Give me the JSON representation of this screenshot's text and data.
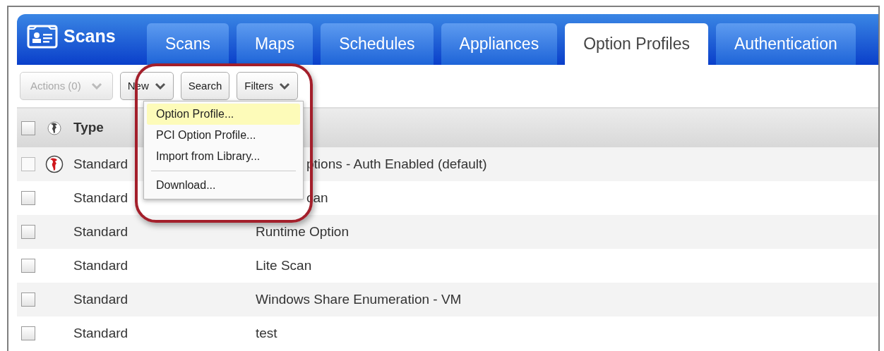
{
  "app": {
    "title": "Scans"
  },
  "tabs": [
    {
      "label": "Scans",
      "selected": false
    },
    {
      "label": "Maps",
      "selected": false
    },
    {
      "label": "Schedules",
      "selected": false
    },
    {
      "label": "Appliances",
      "selected": false
    },
    {
      "label": "Option Profiles",
      "selected": true
    },
    {
      "label": "Authentication",
      "selected": false
    }
  ],
  "toolbar": [
    {
      "label": "Actions (0)",
      "dropdown": true,
      "disabled": true
    },
    {
      "label": "New",
      "dropdown": true,
      "disabled": false
    },
    {
      "label": "Search",
      "dropdown": false,
      "disabled": false
    },
    {
      "label": "Filters",
      "dropdown": true,
      "disabled": false
    }
  ],
  "table": {
    "columns": [
      "Type"
    ],
    "select_all_checked": false,
    "rows": [
      {
        "type": "Standard",
        "title": "ptions - Auth Enabled (default)",
        "global": true,
        "covered": true,
        "checked": false
      },
      {
        "type": "Standard",
        "title": "can",
        "global": false,
        "covered": true,
        "checked": false
      },
      {
        "type": "Standard",
        "title": "Runtime Option",
        "global": false,
        "covered": false,
        "checked": false
      },
      {
        "type": "Standard",
        "title": "Lite Scan",
        "global": false,
        "covered": false,
        "checked": false
      },
      {
        "type": "Standard",
        "title": "Windows Share Enumeration - VM",
        "global": false,
        "covered": false,
        "checked": false
      },
      {
        "type": "Standard",
        "title": "test",
        "global": false,
        "covered": false,
        "checked": false
      }
    ]
  },
  "new_menu": {
    "items": [
      {
        "label": "Option Profile...",
        "kind": "item",
        "selected": true
      },
      {
        "label": "PCI Option Profile...",
        "kind": "item",
        "selected": false
      },
      {
        "label": "Import from Library...",
        "kind": "item",
        "selected": false
      },
      {
        "kind": "divider"
      },
      {
        "label": "Download...",
        "kind": "item",
        "selected": false
      }
    ]
  }
}
